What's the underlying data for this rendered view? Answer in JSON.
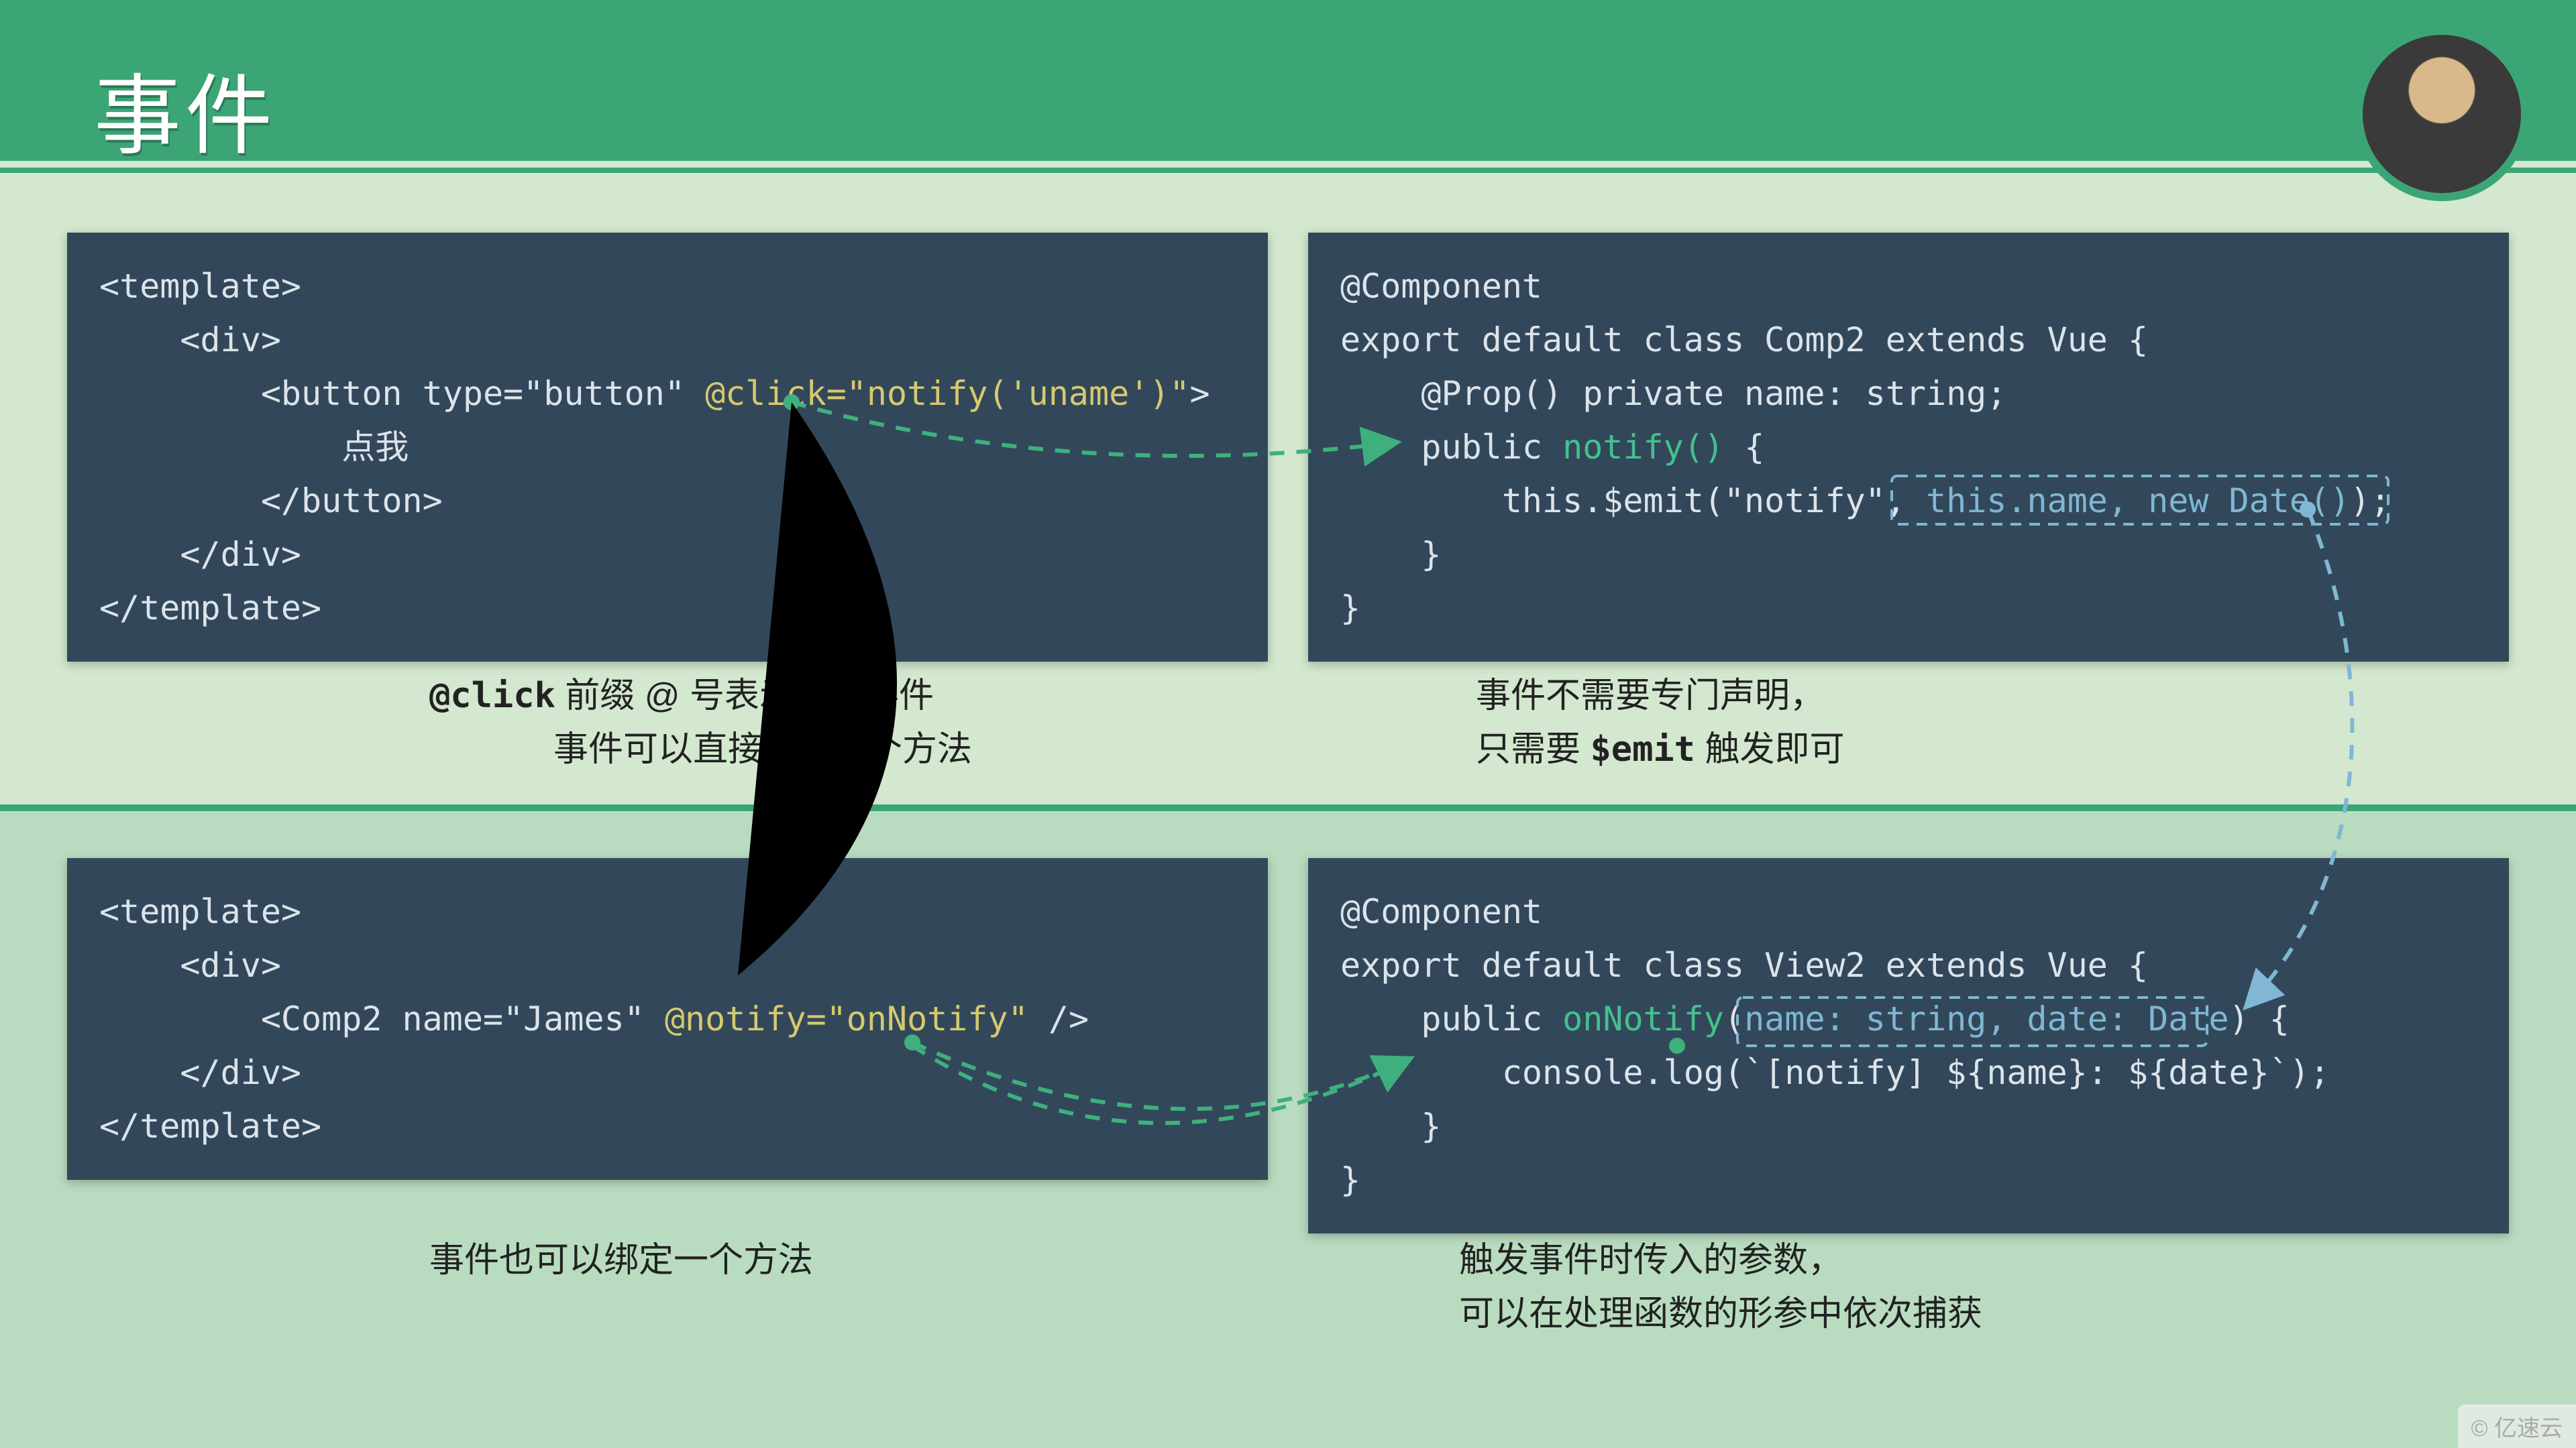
{
  "title": "事件",
  "box1": {
    "l1": "<template>",
    "l2": "    <div>",
    "l3a": "        <button type=\"button\" ",
    "l3b": "@click=\"notify('uname')\"",
    "l3c": ">",
    "l4": "            点我",
    "l5": "        </button>",
    "l6": "    </div>",
    "l7": "</template>"
  },
  "cap1": {
    "pre": "@click",
    "line1": " 前缀 @ 号表示绑定事件",
    "line2": "事件可以直接调用一个方法"
  },
  "box2": {
    "l1": "@Component",
    "l2": "export default class Comp2 extends Vue {",
    "l3": "    @Prop() private name: string;",
    "l4a": "    public ",
    "l4b": "notify()",
    "l4c": " {",
    "l5a": "        this.$emit(\"notify\", ",
    "l5b": "this.name, new Date()",
    "l5c": ");",
    "l6": "    }",
    "l7": "}"
  },
  "cap2": {
    "line1": "事件不需要专门声明，",
    "line2a": "只需要 ",
    "line2b": "$emit",
    "line2c": " 触发即可"
  },
  "box3": {
    "l1": "<template>",
    "l2": "    <div>",
    "l3a": "        <Comp2 name=\"James\" ",
    "l3b": "@notify=\"onNotify\"",
    "l3c": " />",
    "l4": "    </div>",
    "l5": "</template>"
  },
  "cap3": "事件也可以绑定一个方法",
  "box4": {
    "l1": "@Component",
    "l2": "export default class View2 extends Vue {",
    "l3a": "    public ",
    "l3b": "onNotify",
    "l3c": "(",
    "l3d": "name: string, date: Date",
    "l3e": ") {",
    "l4": "        console.log(`[notify] ${name}: ${date}`);",
    "l5": "    }",
    "l6": "}"
  },
  "cap4": {
    "line1": "触发事件时传入的参数，",
    "line2": "可以在处理函数的形参中依次捕获"
  },
  "watermark": "© 亿速云"
}
